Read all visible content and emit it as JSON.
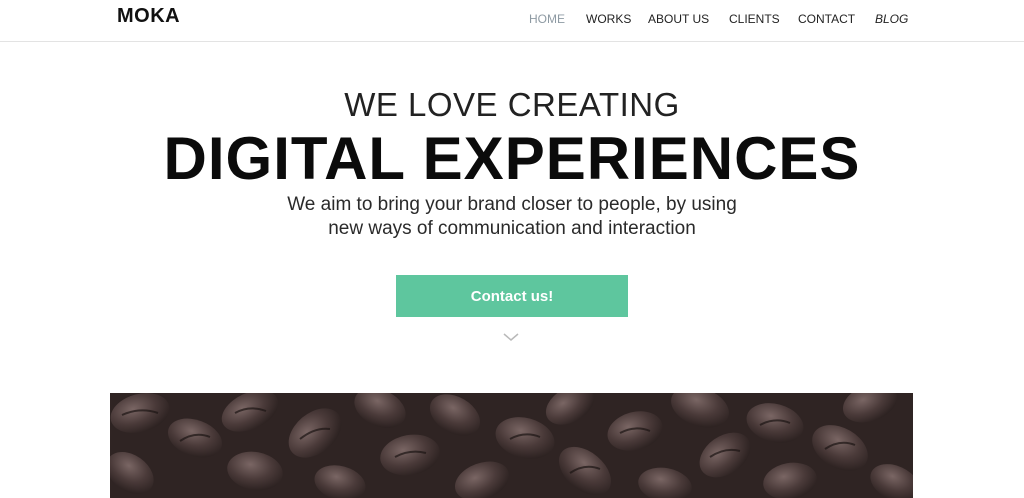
{
  "header": {
    "logo": "MOKA",
    "nav": [
      {
        "label": "HOME",
        "active": true
      },
      {
        "label": "WORKS",
        "active": false
      },
      {
        "label": "ABOUT US",
        "active": false
      },
      {
        "label": "CLIENTS",
        "active": false
      },
      {
        "label": "CONTACT",
        "active": false
      },
      {
        "label": "BLOG",
        "active": false
      }
    ]
  },
  "hero": {
    "pre_title": "WE LOVE CREATING",
    "title": "DIGITAL EXPERIENCES",
    "subtitle_line1": "We aim to bring your brand closer to people, by using",
    "subtitle_line2": "new ways of communication and interaction",
    "cta_label": "Contact us!",
    "scroll_icon": "chevron-down-icon"
  },
  "colors": {
    "accent": "#5ec69e",
    "nav_active": "#8e9aa3",
    "text": "#111111",
    "image_tone": "#3b2e2d"
  }
}
